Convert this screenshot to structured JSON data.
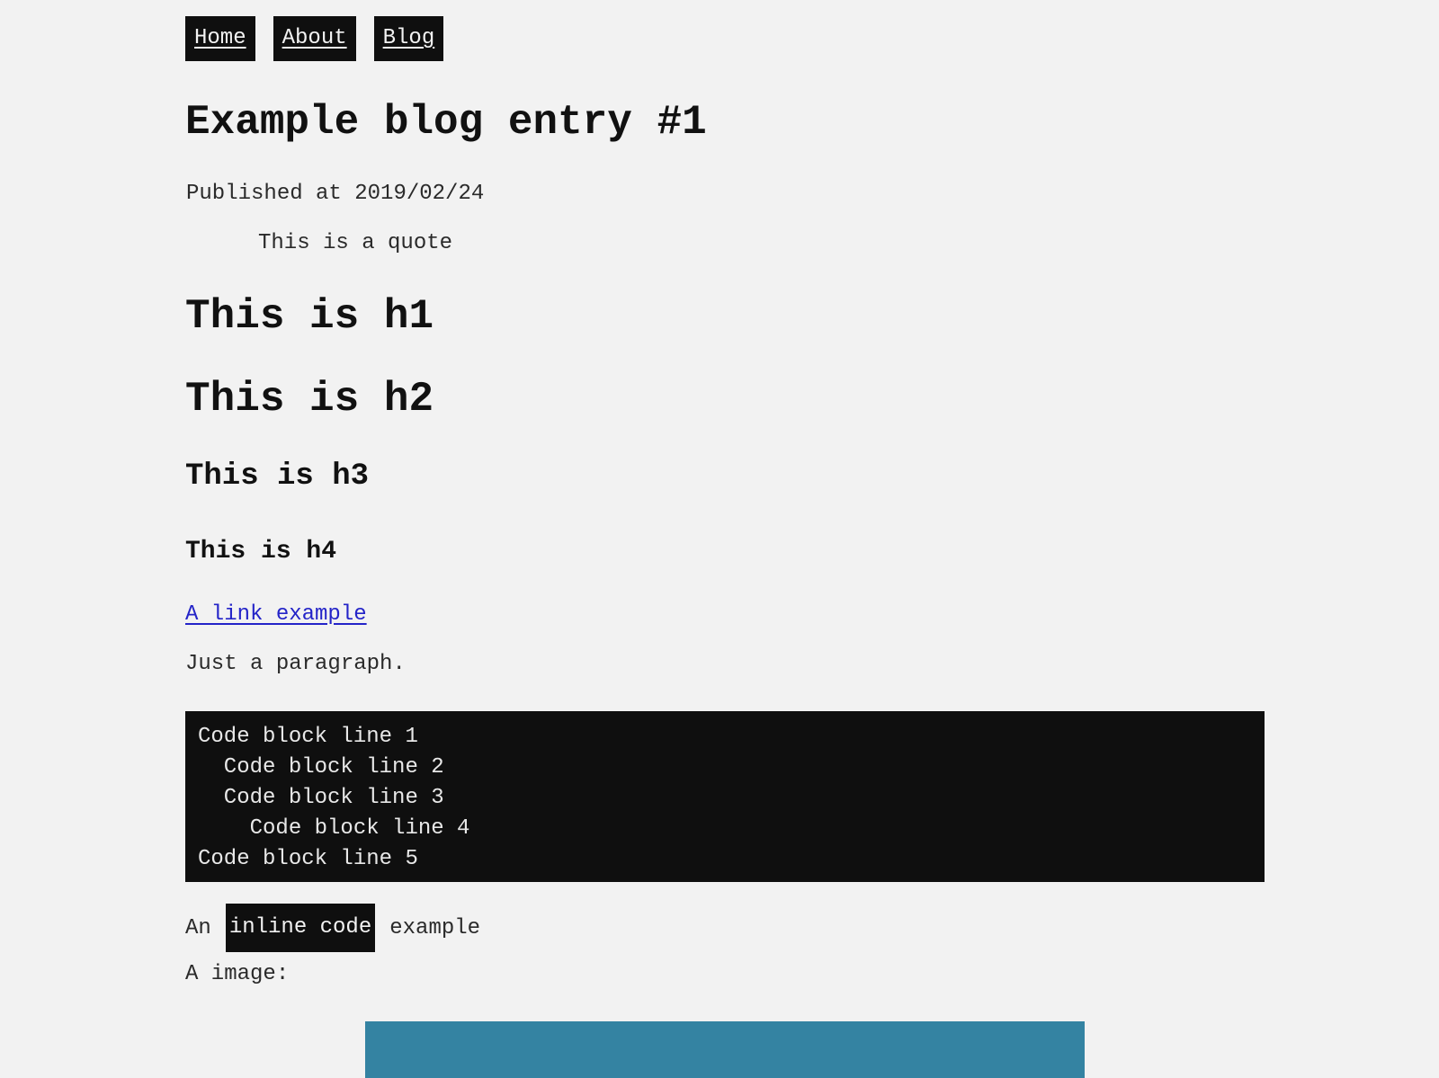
{
  "nav": {
    "items": [
      {
        "label": "Home"
      },
      {
        "label": "About"
      },
      {
        "label": "Blog"
      }
    ]
  },
  "post": {
    "title": "Example blog entry #1",
    "published": "Published at 2019/02/24",
    "quote": "This is a quote",
    "h1": "This is h1",
    "h2": "This is h2",
    "h3": "This is h3",
    "h4": "This is h4",
    "link_text": "A link example",
    "paragraph": "Just a paragraph.",
    "code_lines": [
      "Code block line 1",
      "  Code block line 2",
      "  Code block line 3",
      "    Code block line 4",
      "Code block line 5"
    ],
    "inline_prefix": "An",
    "inline_code": "inline code",
    "inline_suffix": "example",
    "image_label": "A image:"
  },
  "colors": {
    "background": "#f2f2f2",
    "dark": "#0f0f0f",
    "link": "#2424c8",
    "image_fill": "#3483a2"
  }
}
